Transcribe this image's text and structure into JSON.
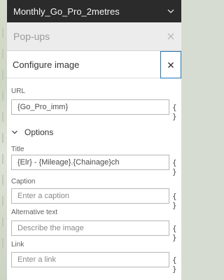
{
  "layer": {
    "title": "Monthly_Go_Pro_2metres",
    "expand_icon": "chevron-down-icon"
  },
  "popups": {
    "title": "Pop-ups",
    "close_icon": "close-icon"
  },
  "configure": {
    "title": "Configure image",
    "close_icon": "close-icon",
    "accent_color": "#1d76b9",
    "url": {
      "label": "URL",
      "value": "{Go_Pro_imm}",
      "expression_icon": "{ }"
    },
    "options": {
      "label": "Options",
      "toggle_icon": "chevron-down-icon"
    },
    "fields": {
      "title": {
        "label": "Title",
        "value": "{Elr} - {Mileage}.{Chainage}ch",
        "expression_icon": "{ }"
      },
      "caption": {
        "label": "Caption",
        "placeholder": "Enter a caption",
        "expression_icon": "{ }"
      },
      "alt_text": {
        "label": "Alternative text",
        "placeholder": "Describe the image",
        "expression_icon": "{ }"
      },
      "link": {
        "label": "Link",
        "placeholder": "Enter a link",
        "expression_icon": "{ }"
      }
    }
  }
}
